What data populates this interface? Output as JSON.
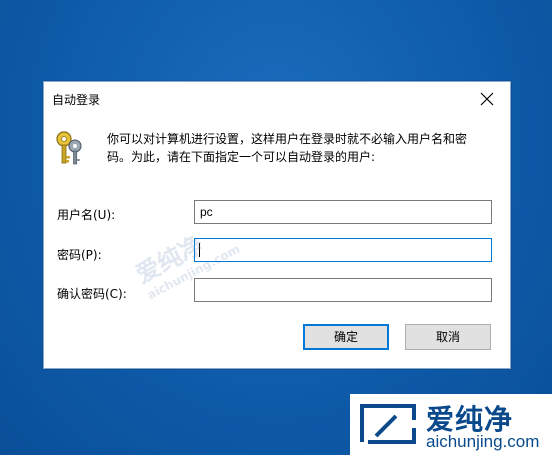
{
  "dialog": {
    "title": "自动登录",
    "description": "你可以对计算机进行设置，这样用户在登录时就不必输入用户名和密码。为此，请在下面指定一个可以自动登录的用户:",
    "fields": {
      "username": {
        "label": "用户名(U):",
        "value": "pc"
      },
      "password": {
        "label": "密码(P):",
        "value": ""
      },
      "confirm": {
        "label": "确认密码(C):",
        "value": ""
      }
    },
    "buttons": {
      "ok": "确定",
      "cancel": "取消"
    }
  },
  "watermark": {
    "center_text": "爱纯净",
    "center_sub": "aichunjing.com",
    "brand_title": "爱纯净",
    "brand_url": "aichunjing.com"
  },
  "icons": [
    "keys-icon",
    "close-icon",
    "watermark-logo-icon"
  ]
}
